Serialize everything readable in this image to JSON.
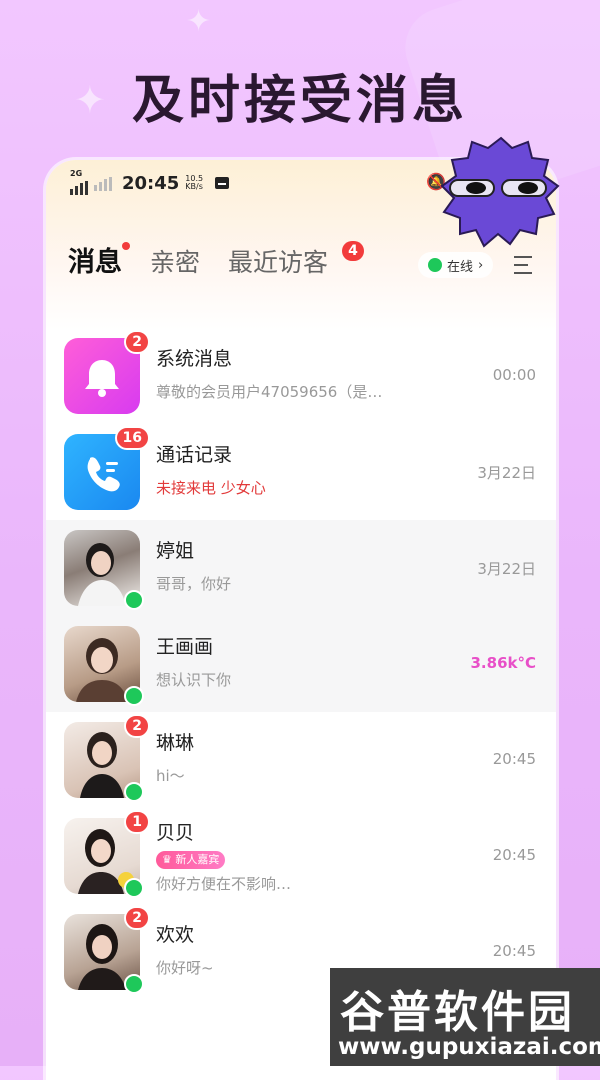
{
  "headline": "及时接受消息",
  "status_bar": {
    "network": "2G",
    "time": "20:45",
    "speed_top": "10.5",
    "speed_bottom": "KB/s"
  },
  "tabs": [
    {
      "label": "消息",
      "active": true,
      "dot": true
    },
    {
      "label": "亲密",
      "active": false
    },
    {
      "label": "最近访客",
      "active": false,
      "count": "4"
    }
  ],
  "online_status": "在线",
  "conversations": [
    {
      "name": "系统消息",
      "preview": "尊敬的会员用户47059656（是…",
      "meta": "00:00",
      "badge": "2",
      "avatar": "bell-icon",
      "color": "#e63fe0"
    },
    {
      "name": "通话记录",
      "preview": "未接来电 少女心",
      "meta": "3月22日",
      "badge": "16",
      "avatar": "phone-icon",
      "color": "#1ea0f5"
    },
    {
      "name": "婷姐",
      "preview": "哥哥，你好",
      "meta": "3月22日",
      "online": true
    },
    {
      "name": "王画画",
      "preview": "想认识下你",
      "meta": "3.86k°C",
      "online": true
    },
    {
      "name": "琳琳",
      "preview": "hi～",
      "meta": "20:45",
      "badge": "2",
      "online": true
    },
    {
      "name": "贝贝",
      "tag": "新人嘉宾",
      "preview": "你好方便在不影响…",
      "meta": "20:45",
      "badge": "1",
      "online": true
    },
    {
      "name": "欢欢",
      "preview": "你好呀~",
      "meta": "20:45",
      "badge": "2",
      "online": true
    }
  ],
  "watermark": {
    "title": "谷普软件园",
    "url": "www.gupuxiazai.com"
  }
}
